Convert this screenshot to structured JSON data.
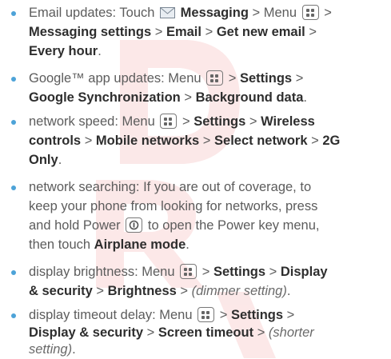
{
  "icons": {
    "bullet": "bullet-dot",
    "menu": "menu-key-icon",
    "power": "power-key-icon",
    "messaging": "envelope-icon"
  },
  "colors": {
    "bullet": "#4da3d8",
    "text": "#5c5c5c",
    "bold": "#2e2e2e",
    "watermark": "#f6d3d3"
  },
  "items": {
    "email": {
      "l1a": "Email updates: Touch",
      "l1b": "Messaging",
      "l1c": "> Menu",
      "l1d": ">",
      "l2a": "Messaging settings",
      "l2b": ">",
      "l2c": "Email",
      "l2d": ">",
      "l2e": "Get new email",
      "l2f": ">",
      "l3a": "Every hour",
      "l3b": "."
    },
    "google": {
      "l1a": "Google™ app updates:  Menu",
      "l1b": ">",
      "l1c": "Settings",
      "l1d": ">",
      "l2a": "Google Synchronization",
      "l2b": ">",
      "l2c": "Background data",
      "l2d": "."
    },
    "network": {
      "l1a": "network speed:  Menu",
      "l1b": ">",
      "l1c": "Settings",
      "l1d": ">",
      "l1e": "Wireless",
      "l2a": "controls",
      "l2b": ">",
      "l2c": "Mobile networks",
      "l2d": ">",
      "l2e": "Select network",
      "l2f": ">",
      "l2g": "2G",
      "l3a": "Only",
      "l3b": "."
    },
    "searching": {
      "l1": "network searching: If you are out of coverage, to",
      "l2": "keep your phone from looking for networks, press",
      "l3a": "and hold Power",
      "l3b": "to open the Power key menu,",
      "l4a": "then touch",
      "l4b": "Airplane mode",
      "l4c": "."
    },
    "brightness": {
      "l1a": "display brightness:  Menu",
      "l1b": ">",
      "l1c": "Settings",
      "l1d": ">",
      "l1e": "Display",
      "l2a": "& security",
      "l2b": ">",
      "l2c": "Brightness",
      "l2d": ">",
      "l2e": "(dimmer setting)",
      "l2f": "."
    },
    "timeout": {
      "l1a": "display timeout delay:  Menu",
      "l1b": ">",
      "l1c": "Settings",
      "l1d": ">",
      "l2a": "Display & security",
      "l2b": ">",
      "l2c": "Screen timeout",
      "l2d": ">",
      "l2e": "(shorter",
      "l3a": "setting)",
      "l3b": "."
    }
  }
}
